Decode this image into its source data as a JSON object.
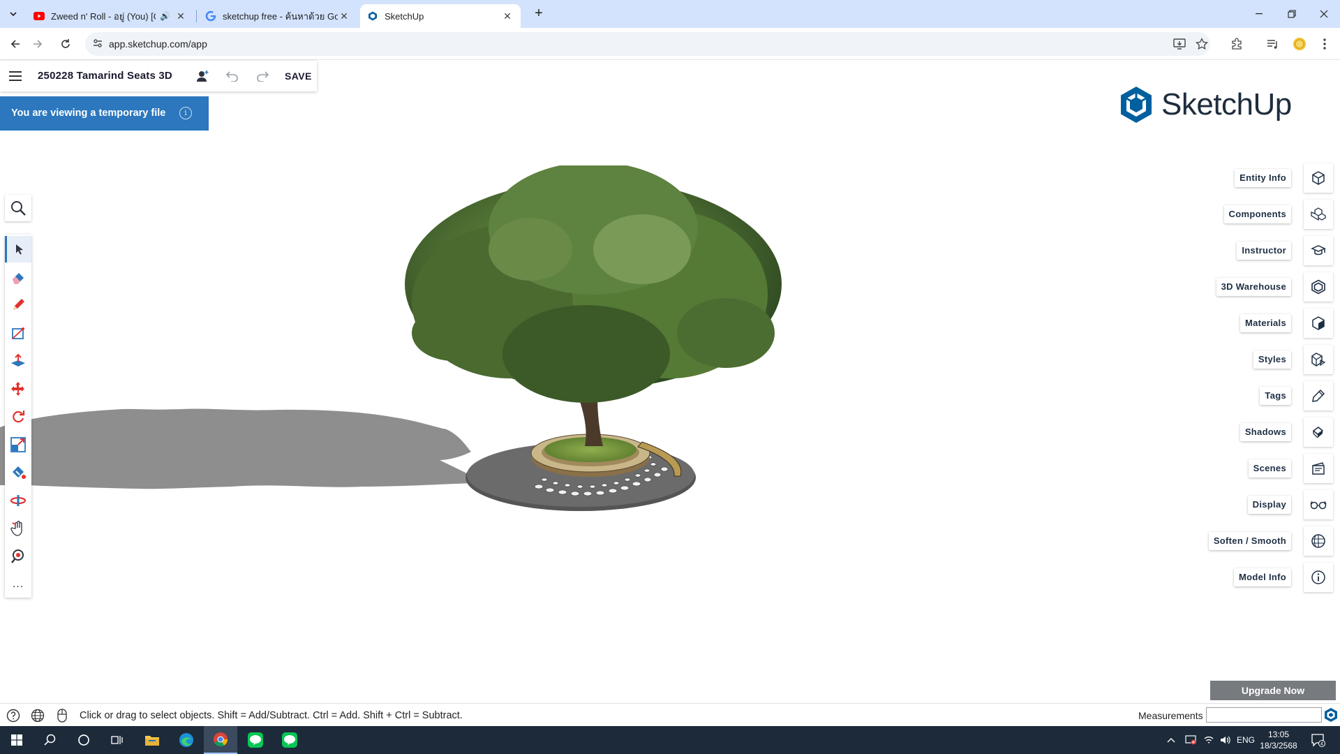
{
  "browser": {
    "tabs": [
      {
        "title": "Zweed n' Roll - อยู่ (You) [Of",
        "active": false,
        "audio": true
      },
      {
        "title": "sketchup free - ค้นหาด้วย Google",
        "active": false,
        "audio": false
      },
      {
        "title": "SketchUp",
        "active": true,
        "audio": false
      }
    ],
    "url": "app.sketchup.com/app"
  },
  "app": {
    "file_name": "250228 Tamarind Seats 3D",
    "save_label": "SAVE",
    "temp_banner": "You are viewing a temporary file",
    "logo_text": "SketchUp",
    "brand_color": "#2c77bd",
    "left_tools": [
      {
        "name": "search-icon"
      },
      {
        "name": "select-tool-icon",
        "active": true
      },
      {
        "name": "eraser-tool-icon"
      },
      {
        "name": "pencil-tool-icon"
      },
      {
        "name": "rectangle-tool-icon"
      },
      {
        "name": "push-pull-tool-icon"
      },
      {
        "name": "move-tool-icon"
      },
      {
        "name": "rotate-tool-icon"
      },
      {
        "name": "scale-tool-icon"
      },
      {
        "name": "paint-bucket-tool-icon"
      },
      {
        "name": "orbit-tool-icon"
      },
      {
        "name": "pan-tool-icon"
      },
      {
        "name": "zoom-extents-tool-icon"
      },
      {
        "name": "more-tools-icon",
        "label": "..."
      }
    ],
    "right_panels": [
      {
        "label": "Entity Info",
        "icon": "entity-info-icon"
      },
      {
        "label": "Components",
        "icon": "components-icon"
      },
      {
        "label": "Instructor",
        "icon": "instructor-icon"
      },
      {
        "label": "3D Warehouse",
        "icon": "warehouse-icon"
      },
      {
        "label": "Materials",
        "icon": "materials-icon"
      },
      {
        "label": "Styles",
        "icon": "styles-icon"
      },
      {
        "label": "Tags",
        "icon": "tags-icon"
      },
      {
        "label": "Shadows",
        "icon": "shadows-icon"
      },
      {
        "label": "Scenes",
        "icon": "scenes-icon"
      },
      {
        "label": "Display",
        "icon": "display-icon"
      },
      {
        "label": "Soften / Smooth",
        "icon": "soften-smooth-icon"
      },
      {
        "label": "Model Info",
        "icon": "model-info-icon"
      }
    ],
    "upgrade_label": "Upgrade Now",
    "status_text": "Click or drag to select objects. Shift = Add/Subtract. Ctrl = Add. Shift + Ctrl = Subtract.",
    "measurements_label": "Measurements",
    "measurements_value": ""
  },
  "taskbar": {
    "language": "ENG",
    "time": "13:05",
    "date": "18/3/2568",
    "notification_count": "4"
  }
}
